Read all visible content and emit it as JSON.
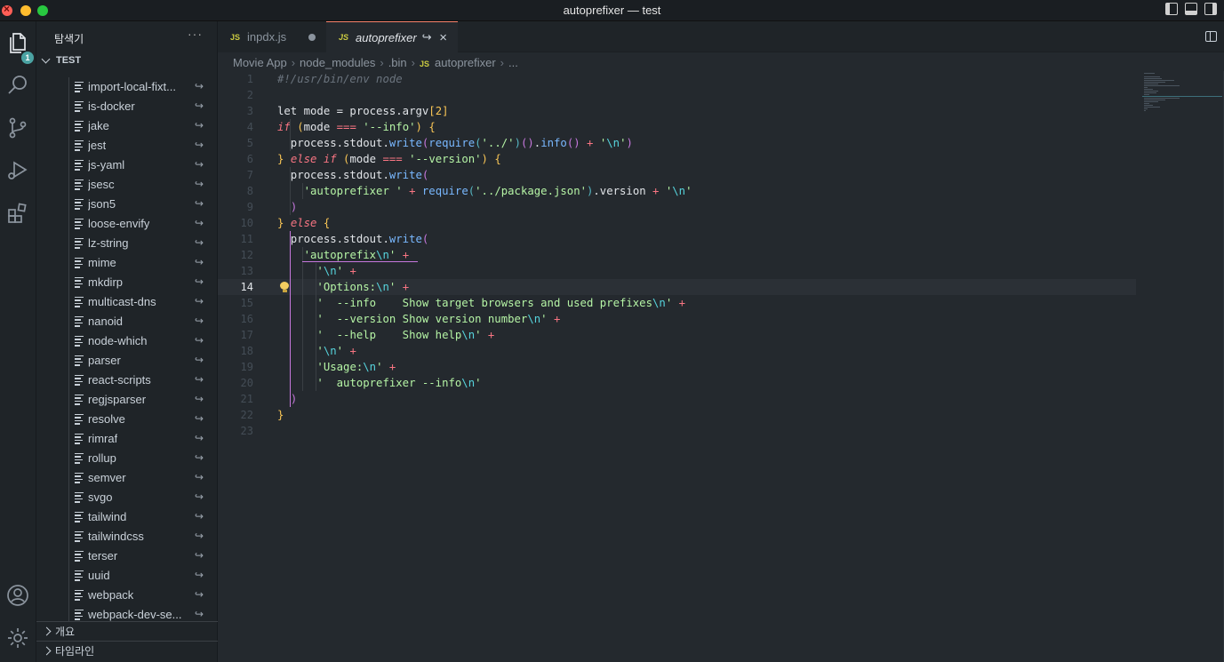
{
  "window": {
    "title": "autoprefixer — test"
  },
  "activity_bar": {
    "explorer_badge": "1"
  },
  "sidebar": {
    "title": "탐색기",
    "more": "···",
    "root_folder": "TEST",
    "items": [
      "import-local-fixt...",
      "is-docker",
      "jake",
      "jest",
      "js-yaml",
      "jsesc",
      "json5",
      "loose-envify",
      "lz-string",
      "mime",
      "mkdirp",
      "multicast-dns",
      "nanoid",
      "node-which",
      "parser",
      "react-scripts",
      "regjsparser",
      "resolve",
      "rimraf",
      "rollup",
      "semver",
      "svgo",
      "tailwind",
      "tailwindcss",
      "terser",
      "uuid",
      "webpack",
      "webpack-dev-se..."
    ],
    "link_glyph": "↪",
    "sections": [
      "개요",
      "타임라인"
    ]
  },
  "tabs": [
    {
      "label": "inpdx.js",
      "lang": "JS",
      "dirty": true
    },
    {
      "label": "autoprefixer",
      "lang": "JS",
      "arrow": "↪",
      "close": "×"
    }
  ],
  "breadcrumb": [
    "Movie App",
    "node_modules",
    ".bin",
    "autoprefixer",
    "..."
  ],
  "breadcrumb_lang": "JS",
  "editor": {
    "active_line": 14
  },
  "code_lines": [
    {
      "n": "1",
      "tokens": [
        [
          "cmt",
          "#!/usr/bin/env node"
        ]
      ]
    },
    {
      "n": "2",
      "tokens": []
    },
    {
      "n": "3",
      "tokens": [
        [
          "pun",
          "let mode = process.argv"
        ],
        [
          "br1",
          "["
        ],
        [
          "num",
          "2"
        ],
        [
          "br1",
          "]"
        ]
      ]
    },
    {
      "n": "4",
      "tokens": [
        [
          "kwi",
          "if "
        ],
        [
          "br1",
          "("
        ],
        [
          "pun",
          "mode "
        ],
        [
          "op",
          "==="
        ],
        [
          "pun",
          " "
        ],
        [
          "strg",
          "'--info'"
        ],
        [
          "br1",
          ")"
        ],
        [
          "pun",
          " "
        ],
        [
          "br1",
          "{"
        ]
      ]
    },
    {
      "n": "5",
      "tokens": [
        [
          "pun",
          "  process.stdout."
        ],
        [
          "fn",
          "write"
        ],
        [
          "br2",
          "("
        ],
        [
          "fn",
          "require"
        ],
        [
          "br3",
          "("
        ],
        [
          "strg",
          "'../'"
        ],
        [
          "br3",
          ")"
        ],
        [
          "br2",
          "()"
        ],
        [
          "pun",
          "."
        ],
        [
          "fn",
          "info"
        ],
        [
          "br2",
          "()"
        ],
        [
          "pun",
          " "
        ],
        [
          "op",
          "+"
        ],
        [
          "pun",
          " "
        ],
        [
          "strg",
          "'"
        ],
        [
          "esc",
          "\\n"
        ],
        [
          "strg",
          "'"
        ],
        [
          "br2",
          ")"
        ]
      ]
    },
    {
      "n": "6",
      "tokens": [
        [
          "br1",
          "}"
        ],
        [
          "pun",
          " "
        ],
        [
          "kwi",
          "else if "
        ],
        [
          "br1",
          "("
        ],
        [
          "pun",
          "mode "
        ],
        [
          "op",
          "==="
        ],
        [
          "pun",
          " "
        ],
        [
          "strg",
          "'--version'"
        ],
        [
          "br1",
          ")"
        ],
        [
          "pun",
          " "
        ],
        [
          "br1",
          "{"
        ]
      ]
    },
    {
      "n": "7",
      "tokens": [
        [
          "pun",
          "  process.stdout."
        ],
        [
          "fn",
          "write"
        ],
        [
          "br2",
          "("
        ]
      ]
    },
    {
      "n": "8",
      "tokens": [
        [
          "pun",
          "    "
        ],
        [
          "strg",
          "'autoprefixer '"
        ],
        [
          "pun",
          " "
        ],
        [
          "op",
          "+"
        ],
        [
          "pun",
          " "
        ],
        [
          "fn",
          "require"
        ],
        [
          "br3",
          "("
        ],
        [
          "strg",
          "'../package.json'"
        ],
        [
          "br3",
          ")"
        ],
        [
          "pun",
          ".version "
        ],
        [
          "op",
          "+"
        ],
        [
          "pun",
          " "
        ],
        [
          "strg",
          "'"
        ],
        [
          "esc",
          "\\n"
        ],
        [
          "strg",
          "'"
        ]
      ]
    },
    {
      "n": "9",
      "tokens": [
        [
          "pun",
          "  "
        ],
        [
          "br2",
          ")"
        ]
      ]
    },
    {
      "n": "10",
      "tokens": [
        [
          "br1",
          "}"
        ],
        [
          "pun",
          " "
        ],
        [
          "kwi",
          "else "
        ],
        [
          "br1",
          "{"
        ]
      ]
    },
    {
      "n": "11",
      "tokens": [
        [
          "pun",
          "  process.stdout."
        ],
        [
          "fn",
          "write"
        ],
        [
          "br2",
          "("
        ]
      ]
    },
    {
      "n": "12",
      "tokens": [
        [
          "pun",
          "    "
        ],
        [
          "strg",
          "'autoprefix"
        ],
        [
          "esc",
          "\\n"
        ],
        [
          "strg",
          "'"
        ],
        [
          "pun",
          " "
        ],
        [
          "op",
          "+"
        ]
      ]
    },
    {
      "n": "13",
      "tokens": [
        [
          "pun",
          "      "
        ],
        [
          "strg",
          "'"
        ],
        [
          "esc",
          "\\n"
        ],
        [
          "strg",
          "'"
        ],
        [
          "pun",
          " "
        ],
        [
          "op",
          "+"
        ]
      ]
    },
    {
      "n": "14",
      "tokens": [
        [
          "pun",
          "      "
        ],
        [
          "strg",
          "'Options:"
        ],
        [
          "esc",
          "\\n"
        ],
        [
          "strg",
          "'"
        ],
        [
          "pun",
          " "
        ],
        [
          "op",
          "+"
        ]
      ]
    },
    {
      "n": "15",
      "tokens": [
        [
          "pun",
          "      "
        ],
        [
          "strg",
          "'  --info    Show target browsers and used prefixes"
        ],
        [
          "esc",
          "\\n"
        ],
        [
          "strg",
          "'"
        ],
        [
          "pun",
          " "
        ],
        [
          "op",
          "+"
        ]
      ]
    },
    {
      "n": "16",
      "tokens": [
        [
          "pun",
          "      "
        ],
        [
          "strg",
          "'  --version Show version number"
        ],
        [
          "esc",
          "\\n"
        ],
        [
          "strg",
          "'"
        ],
        [
          "pun",
          " "
        ],
        [
          "op",
          "+"
        ]
      ]
    },
    {
      "n": "17",
      "tokens": [
        [
          "pun",
          "      "
        ],
        [
          "strg",
          "'  --help    Show help"
        ],
        [
          "esc",
          "\\n"
        ],
        [
          "strg",
          "'"
        ],
        [
          "pun",
          " "
        ],
        [
          "op",
          "+"
        ]
      ]
    },
    {
      "n": "18",
      "tokens": [
        [
          "pun",
          "      "
        ],
        [
          "strg",
          "'"
        ],
        [
          "esc",
          "\\n"
        ],
        [
          "strg",
          "'"
        ],
        [
          "pun",
          " "
        ],
        [
          "op",
          "+"
        ]
      ]
    },
    {
      "n": "19",
      "tokens": [
        [
          "pun",
          "      "
        ],
        [
          "strg",
          "'Usage:"
        ],
        [
          "esc",
          "\\n"
        ],
        [
          "strg",
          "'"
        ],
        [
          "pun",
          " "
        ],
        [
          "op",
          "+"
        ]
      ]
    },
    {
      "n": "20",
      "tokens": [
        [
          "pun",
          "      "
        ],
        [
          "strg",
          "'  autoprefixer --info"
        ],
        [
          "esc",
          "\\n"
        ],
        [
          "strg",
          "'"
        ]
      ]
    },
    {
      "n": "21",
      "tokens": [
        [
          "pun",
          "  "
        ],
        [
          "br2",
          ")"
        ]
      ]
    },
    {
      "n": "22",
      "tokens": [
        [
          "br1",
          "}"
        ]
      ]
    },
    {
      "n": "23",
      "tokens": []
    }
  ]
}
